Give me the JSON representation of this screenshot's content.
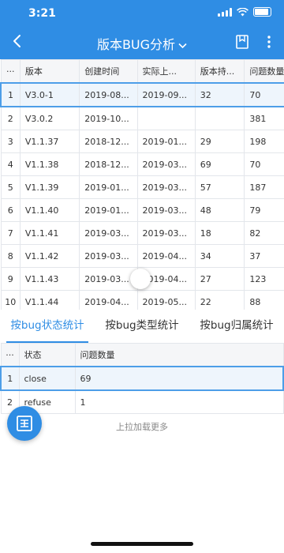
{
  "status": {
    "time": "3:21"
  },
  "header": {
    "title": "版本BUG分析",
    "chevron": "⌵"
  },
  "icons": {
    "back": "back-arrow-icon",
    "bookmark": "bookmark-icon",
    "more": "more-vertical-icon",
    "fab": "report-icon"
  },
  "colors": {
    "brand": "#2f8de4",
    "selected_border": "#4d9ee8"
  },
  "table1": {
    "corner": "···",
    "headers": [
      "版本",
      "创建时间",
      "实际上...",
      "版本持...",
      "问题数量"
    ],
    "rows": [
      {
        "idx": "1",
        "version": "V3.0-1",
        "created": "2019-08...",
        "actual": "2019-09...",
        "duration": "32",
        "count": "70"
      },
      {
        "idx": "2",
        "version": "V3.0.2",
        "created": "2019-10...",
        "actual": "",
        "duration": "",
        "count": "381"
      },
      {
        "idx": "3",
        "version": "V1.1.37",
        "created": "2018-12...",
        "actual": "2019-01...",
        "duration": "29",
        "count": "198"
      },
      {
        "idx": "4",
        "version": "V1.1.38",
        "created": "2018-12...",
        "actual": "2019-03...",
        "duration": "69",
        "count": "70"
      },
      {
        "idx": "5",
        "version": "V1.1.39",
        "created": "2019-01...",
        "actual": "2019-03...",
        "duration": "57",
        "count": "187"
      },
      {
        "idx": "6",
        "version": "V1.1.40",
        "created": "2019-01...",
        "actual": "2019-03...",
        "duration": "48",
        "count": "79"
      },
      {
        "idx": "7",
        "version": "V1.1.41",
        "created": "2019-03...",
        "actual": "2019-03...",
        "duration": "18",
        "count": "82"
      },
      {
        "idx": "8",
        "version": "V1.1.42",
        "created": "2019-03...",
        "actual": "2019-04...",
        "duration": "34",
        "count": "37"
      },
      {
        "idx": "9",
        "version": "V1.1.43",
        "created": "2019-03...",
        "actual": "2019-04...",
        "duration": "27",
        "count": "123"
      },
      {
        "idx": "10",
        "version": "V1.1.44",
        "created": "2019-04...",
        "actual": "2019-05...",
        "duration": "22",
        "count": "88"
      }
    ]
  },
  "tabs": [
    "按bug状态统计",
    "按bug类型统计",
    "按bug归属统计"
  ],
  "table2": {
    "corner": "···",
    "headers": [
      "状态",
      "问题数量"
    ],
    "rows": [
      {
        "idx": "1",
        "status": "close",
        "count": "69"
      },
      {
        "idx": "2",
        "status": "refuse",
        "count": "1"
      }
    ]
  },
  "footer": {
    "load_more": "上拉加载更多"
  }
}
